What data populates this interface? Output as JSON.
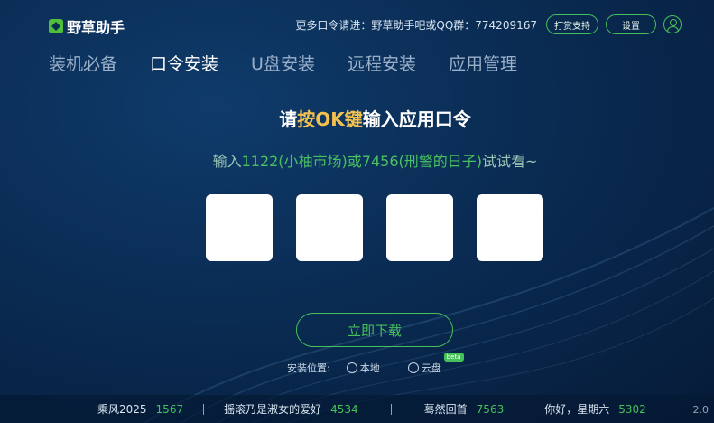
{
  "brand": {
    "name": "野草助手"
  },
  "header": {
    "info": "更多口令请进：野草助手吧或QQ群：774209167",
    "support_label": "打赏支持",
    "settings_label": "设置"
  },
  "tabs": [
    {
      "label": "装机必备"
    },
    {
      "label": "口令安装"
    },
    {
      "label": "U盘安装"
    },
    {
      "label": "远程安装"
    },
    {
      "label": "应用管理"
    }
  ],
  "main": {
    "title_prefix": "请",
    "title_highlight": "按OK键",
    "title_suffix": "输入应用口令",
    "hint_prefix": "输入",
    "hint_codes": "1122(小柚市场)或7456(刑警的日子)",
    "hint_suffix": "试试看~",
    "download_label": "立即下载",
    "install_label": "安装位置:",
    "local_label": "本地",
    "cloud_label": "云盘",
    "beta_label": "beta"
  },
  "ticker": [
    {
      "name": "乘风2025",
      "count": "1567"
    },
    {
      "name": "摇滚乃是淑女的爱好",
      "count": "4534"
    },
    {
      "name": "蓦然回首",
      "count": "7563"
    },
    {
      "name": "你好，星期六",
      "count": "5302"
    }
  ],
  "version": "2.0"
}
